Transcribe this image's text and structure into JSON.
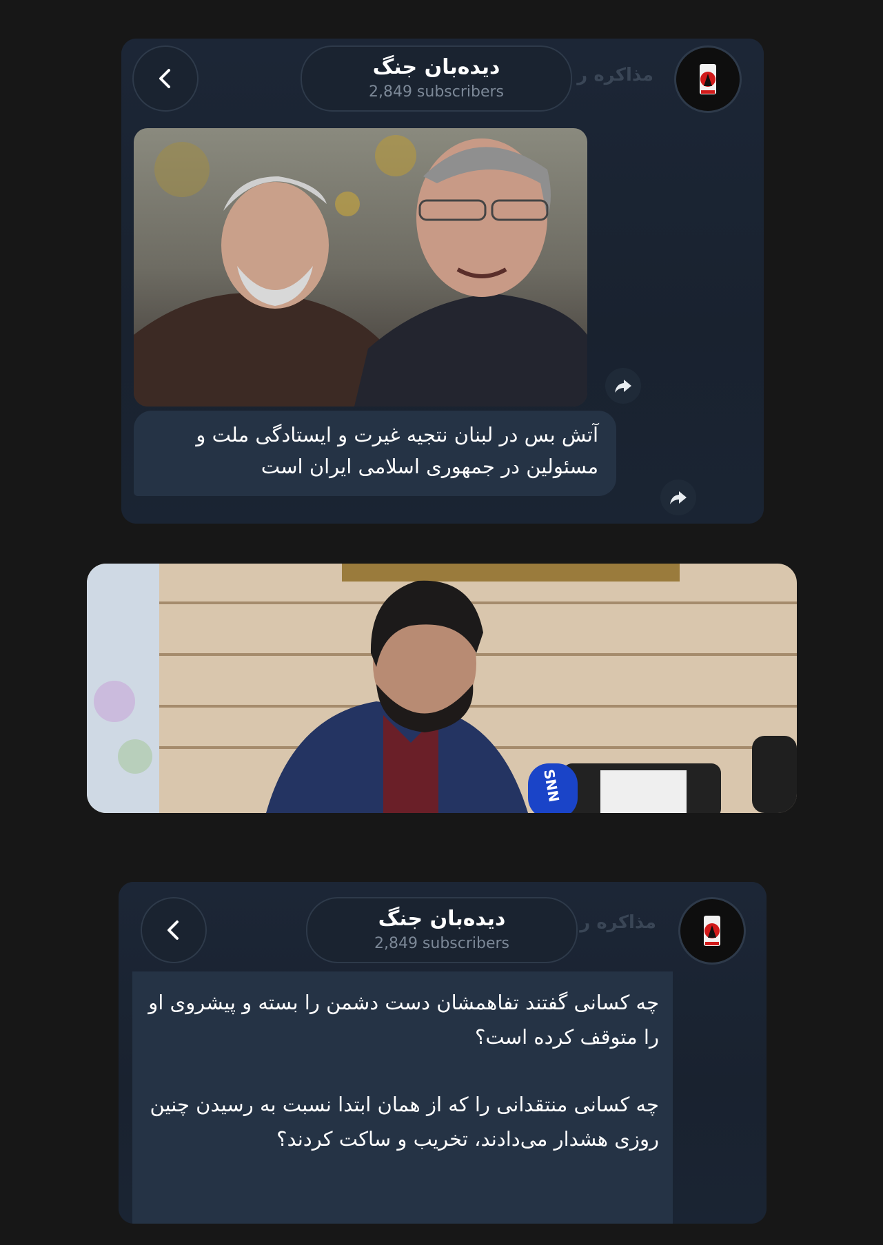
{
  "post1": {
    "channel_name": "دیده‌بان جنگ",
    "subscribers": "2,849 subscribers",
    "background_text": "مذاکره ر",
    "message": "آتش بس در لبنان نتجیه غیرت و ایستادگی ملت و مسئولین در جمهوری اسلامی ایران است"
  },
  "post2": {
    "channel_name": "دیده‌بان جنگ",
    "subscribers": "2,849 subscribers",
    "background_text": "مذاکره ر",
    "paragraph1": "چه کسانی گفتند تفاهمشان دست دشمن را بسته و پیشروی او را متوقف کرده است؟",
    "paragraph2": "چه کسانی منتقدانی را که از همان ابتدا نسبت به رسیدن چنین روزی هشدار می‌دادند، تخریب و ساکت کردند؟"
  },
  "photo_microphone_logo": "SNN",
  "colors": {
    "page_bg": "#171717",
    "panel_bg": "#1b2533",
    "bubble_bg": "#253345",
    "subtitle": "#7c8897"
  },
  "icons": {
    "back": "chevron-left-icon",
    "share": "share-arrow-icon",
    "avatar": "channel-logo-icon"
  }
}
